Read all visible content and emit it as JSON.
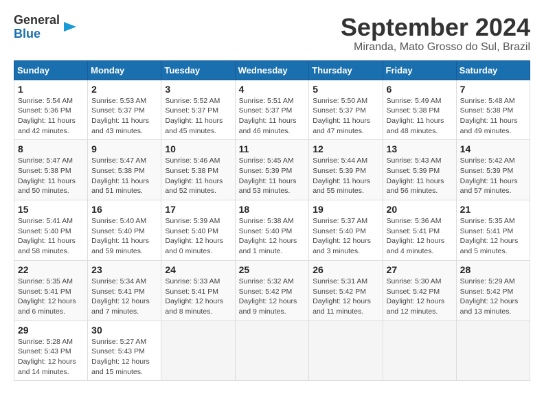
{
  "header": {
    "logo_general": "General",
    "logo_blue": "Blue",
    "title": "September 2024",
    "subtitle": "Miranda, Mato Grosso do Sul, Brazil"
  },
  "weekdays": [
    "Sunday",
    "Monday",
    "Tuesday",
    "Wednesday",
    "Thursday",
    "Friday",
    "Saturday"
  ],
  "weeks": [
    [
      {
        "day": "1",
        "sunrise": "5:54 AM",
        "sunset": "5:36 PM",
        "daylight": "11 hours and 42 minutes."
      },
      {
        "day": "2",
        "sunrise": "5:53 AM",
        "sunset": "5:37 PM",
        "daylight": "11 hours and 43 minutes."
      },
      {
        "day": "3",
        "sunrise": "5:52 AM",
        "sunset": "5:37 PM",
        "daylight": "11 hours and 45 minutes."
      },
      {
        "day": "4",
        "sunrise": "5:51 AM",
        "sunset": "5:37 PM",
        "daylight": "11 hours and 46 minutes."
      },
      {
        "day": "5",
        "sunrise": "5:50 AM",
        "sunset": "5:37 PM",
        "daylight": "11 hours and 47 minutes."
      },
      {
        "day": "6",
        "sunrise": "5:49 AM",
        "sunset": "5:38 PM",
        "daylight": "11 hours and 48 minutes."
      },
      {
        "day": "7",
        "sunrise": "5:48 AM",
        "sunset": "5:38 PM",
        "daylight": "11 hours and 49 minutes."
      }
    ],
    [
      {
        "day": "8",
        "sunrise": "5:47 AM",
        "sunset": "5:38 PM",
        "daylight": "11 hours and 50 minutes."
      },
      {
        "day": "9",
        "sunrise": "5:47 AM",
        "sunset": "5:38 PM",
        "daylight": "11 hours and 51 minutes."
      },
      {
        "day": "10",
        "sunrise": "5:46 AM",
        "sunset": "5:38 PM",
        "daylight": "11 hours and 52 minutes."
      },
      {
        "day": "11",
        "sunrise": "5:45 AM",
        "sunset": "5:39 PM",
        "daylight": "11 hours and 53 minutes."
      },
      {
        "day": "12",
        "sunrise": "5:44 AM",
        "sunset": "5:39 PM",
        "daylight": "11 hours and 55 minutes."
      },
      {
        "day": "13",
        "sunrise": "5:43 AM",
        "sunset": "5:39 PM",
        "daylight": "11 hours and 56 minutes."
      },
      {
        "day": "14",
        "sunrise": "5:42 AM",
        "sunset": "5:39 PM",
        "daylight": "11 hours and 57 minutes."
      }
    ],
    [
      {
        "day": "15",
        "sunrise": "5:41 AM",
        "sunset": "5:40 PM",
        "daylight": "11 hours and 58 minutes."
      },
      {
        "day": "16",
        "sunrise": "5:40 AM",
        "sunset": "5:40 PM",
        "daylight": "11 hours and 59 minutes."
      },
      {
        "day": "17",
        "sunrise": "5:39 AM",
        "sunset": "5:40 PM",
        "daylight": "12 hours and 0 minutes."
      },
      {
        "day": "18",
        "sunrise": "5:38 AM",
        "sunset": "5:40 PM",
        "daylight": "12 hours and 1 minute."
      },
      {
        "day": "19",
        "sunrise": "5:37 AM",
        "sunset": "5:40 PM",
        "daylight": "12 hours and 3 minutes."
      },
      {
        "day": "20",
        "sunrise": "5:36 AM",
        "sunset": "5:41 PM",
        "daylight": "12 hours and 4 minutes."
      },
      {
        "day": "21",
        "sunrise": "5:35 AM",
        "sunset": "5:41 PM",
        "daylight": "12 hours and 5 minutes."
      }
    ],
    [
      {
        "day": "22",
        "sunrise": "5:35 AM",
        "sunset": "5:41 PM",
        "daylight": "12 hours and 6 minutes."
      },
      {
        "day": "23",
        "sunrise": "5:34 AM",
        "sunset": "5:41 PM",
        "daylight": "12 hours and 7 minutes."
      },
      {
        "day": "24",
        "sunrise": "5:33 AM",
        "sunset": "5:41 PM",
        "daylight": "12 hours and 8 minutes."
      },
      {
        "day": "25",
        "sunrise": "5:32 AM",
        "sunset": "5:42 PM",
        "daylight": "12 hours and 9 minutes."
      },
      {
        "day": "26",
        "sunrise": "5:31 AM",
        "sunset": "5:42 PM",
        "daylight": "12 hours and 11 minutes."
      },
      {
        "day": "27",
        "sunrise": "5:30 AM",
        "sunset": "5:42 PM",
        "daylight": "12 hours and 12 minutes."
      },
      {
        "day": "28",
        "sunrise": "5:29 AM",
        "sunset": "5:42 PM",
        "daylight": "12 hours and 13 minutes."
      }
    ],
    [
      {
        "day": "29",
        "sunrise": "5:28 AM",
        "sunset": "5:43 PM",
        "daylight": "12 hours and 14 minutes."
      },
      {
        "day": "30",
        "sunrise": "5:27 AM",
        "sunset": "5:43 PM",
        "daylight": "12 hours and 15 minutes."
      },
      null,
      null,
      null,
      null,
      null
    ]
  ]
}
